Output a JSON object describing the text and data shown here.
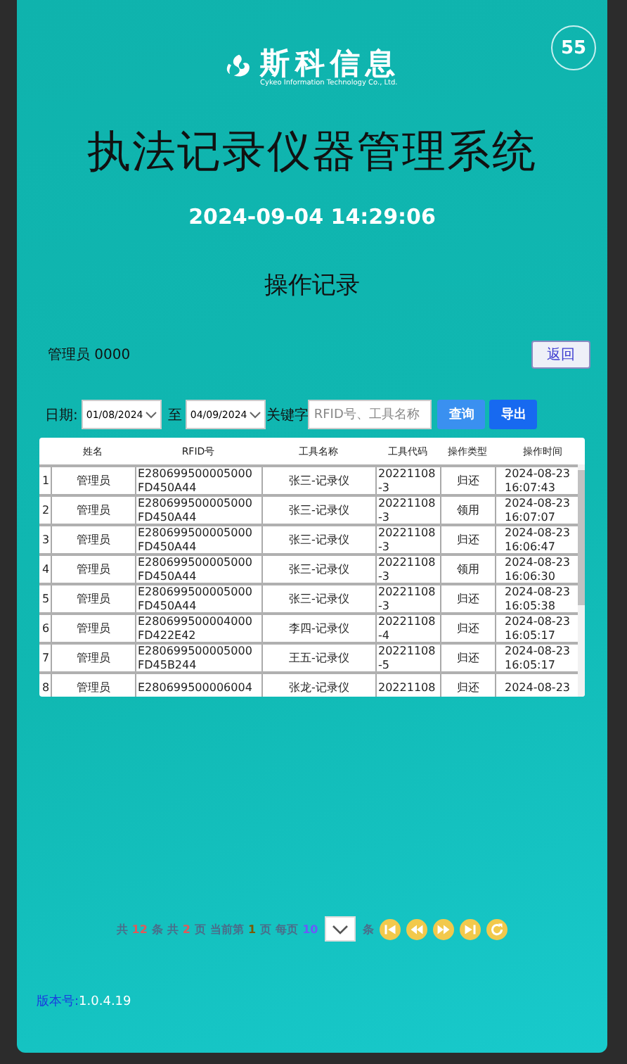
{
  "header": {
    "logo_name": "斯科信息",
    "logo_subtitle": "Cykeo Information Technology Co., Ltd.",
    "badge": "55"
  },
  "title": "执法记录仪器管理系统",
  "datetime": "2024-09-04 14:29:06",
  "subtitle": "操作记录",
  "user": "管理员 0000",
  "back_button": "返回",
  "filter": {
    "date_label": "日期:",
    "from": "01/08/2024",
    "to_label": "至",
    "to": "04/09/2024",
    "keyword_label": "关键字",
    "keyword_placeholder": "RFID号、工具名称",
    "search_button": "查询",
    "export_button": "导出"
  },
  "table": {
    "columns": [
      "姓名",
      "RFID号",
      "工具名称",
      "工具代码",
      "操作类型",
      "操作时间"
    ],
    "rows": [
      {
        "index": "1",
        "name": "管理员",
        "rfid": "E280699500005000 FD450A44",
        "tool": "张三-记录仪",
        "code": "20221108 -3",
        "type": "归还",
        "time": "2024-08-23 16:07:43"
      },
      {
        "index": "2",
        "name": "管理员",
        "rfid": "E280699500005000 FD450A44",
        "tool": "张三-记录仪",
        "code": "20221108 -3",
        "type": "领用",
        "time": "2024-08-23 16:07:07"
      },
      {
        "index": "3",
        "name": "管理员",
        "rfid": "E280699500005000 FD450A44",
        "tool": "张三-记录仪",
        "code": "20221108 -3",
        "type": "归还",
        "time": "2024-08-23 16:06:47"
      },
      {
        "index": "4",
        "name": "管理员",
        "rfid": "E280699500005000 FD450A44",
        "tool": "张三-记录仪",
        "code": "20221108 -3",
        "type": "领用",
        "time": "2024-08-23 16:06:30"
      },
      {
        "index": "5",
        "name": "管理员",
        "rfid": "E280699500005000 FD450A44",
        "tool": "张三-记录仪",
        "code": "20221108 -3",
        "type": "归还",
        "time": "2024-08-23 16:05:38"
      },
      {
        "index": "6",
        "name": "管理员",
        "rfid": "E280699500004000 FD422E42",
        "tool": "李四-记录仪",
        "code": "20221108 -4",
        "type": "归还",
        "time": "2024-08-23 16:05:17"
      },
      {
        "index": "7",
        "name": "管理员",
        "rfid": "E280699500005000 FD45B244",
        "tool": "王五-记录仪",
        "code": "20221108 -5",
        "type": "归还",
        "time": "2024-08-23 16:05:17"
      },
      {
        "index": "8",
        "name": "管理员",
        "rfid": "E280699500006004",
        "tool": "张龙-记录仪",
        "code": "20221108",
        "type": "归还",
        "time": "2024-08-23"
      }
    ]
  },
  "pagination": {
    "parts": [
      {
        "text": "共",
        "color": "#4a6e8a"
      },
      {
        "text": "12",
        "color": "#e05a5a"
      },
      {
        "text": "条",
        "color": "#4a6e8a"
      },
      {
        "text": "共",
        "color": "#4a6e8a"
      },
      {
        "text": "2",
        "color": "#e05a5a"
      },
      {
        "text": "页",
        "color": "#4a6e8a"
      },
      {
        "text": "当前第",
        "color": "#4a6e8a"
      },
      {
        "text": "1",
        "color": "#7a5a00"
      },
      {
        "text": "页",
        "color": "#4a6e8a"
      },
      {
        "text": "每页",
        "color": "#4a6e8a"
      },
      {
        "text": "10",
        "color": "#6a5af9"
      }
    ],
    "after_select": "条"
  },
  "version": {
    "label": "版本号:",
    "value": "1.0.4.19"
  }
}
